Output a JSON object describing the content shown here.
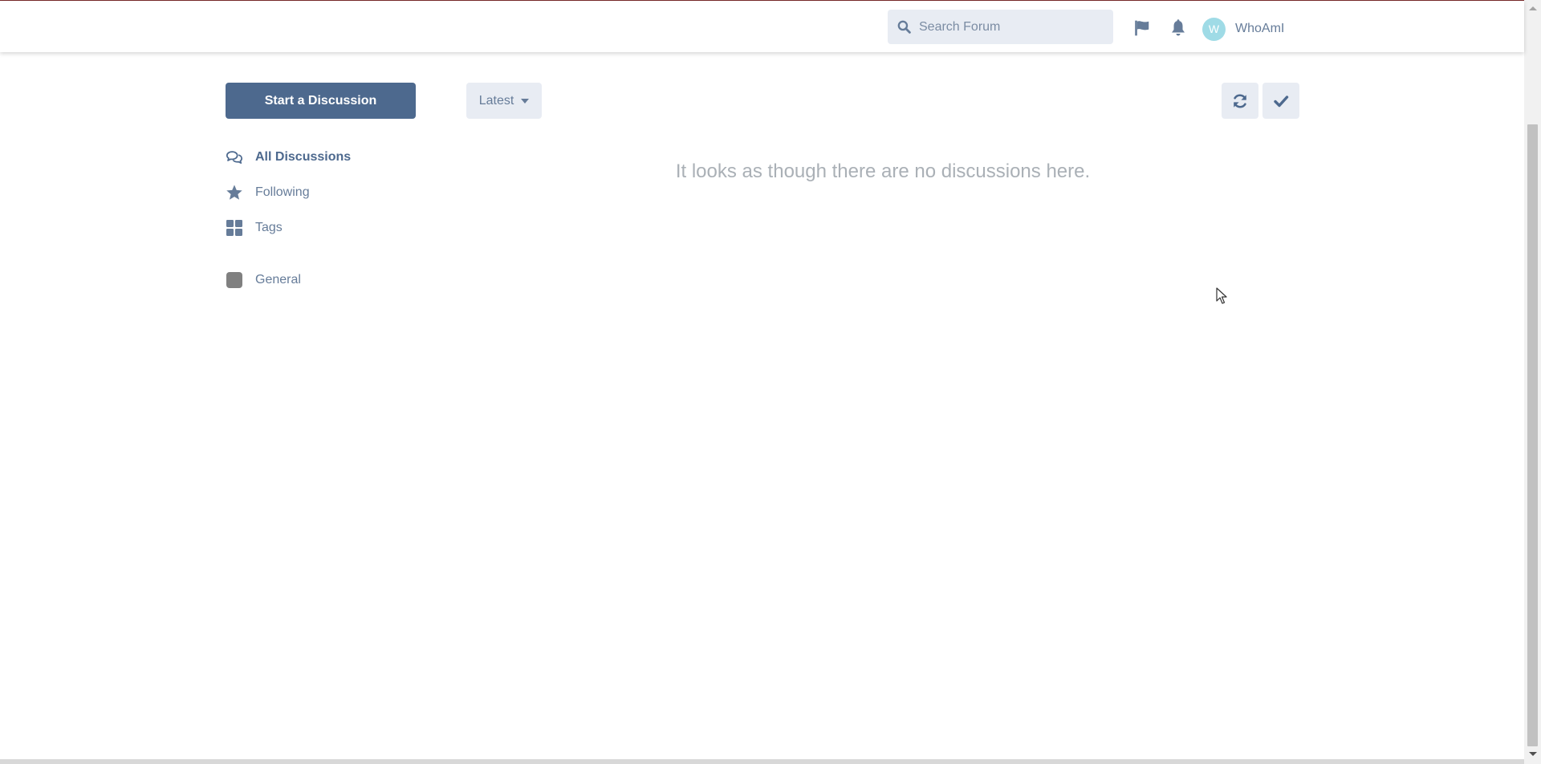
{
  "header": {
    "search": {
      "placeholder": "Search Forum",
      "value": ""
    },
    "flag_icon": "flag-icon",
    "notifications_icon": "bell-icon",
    "user": {
      "avatar_letter": "W",
      "username": "WhoAmI",
      "avatar_color": "#9fdbe6"
    }
  },
  "toolbar": {
    "start_label": "Start a Discussion",
    "sort_label": "Latest",
    "refresh_icon": "refresh-icon",
    "mark_read_icon": "check-icon"
  },
  "nav": {
    "items": [
      {
        "label": "All Discussions",
        "icon": "comments-icon",
        "active": true
      },
      {
        "label": "Following",
        "icon": "star-icon",
        "active": false
      },
      {
        "label": "Tags",
        "icon": "th-large-icon",
        "active": false
      },
      {
        "label": "General",
        "icon": "tag-swatch",
        "color": "#808080",
        "active": false
      }
    ]
  },
  "main": {
    "empty_message": "It looks as though there are no discussions here."
  },
  "colors": {
    "primary": "#4d698e",
    "muted_text": "#667c99",
    "control_bg": "#e8ecf3",
    "empty_text": "#aab0b6"
  }
}
